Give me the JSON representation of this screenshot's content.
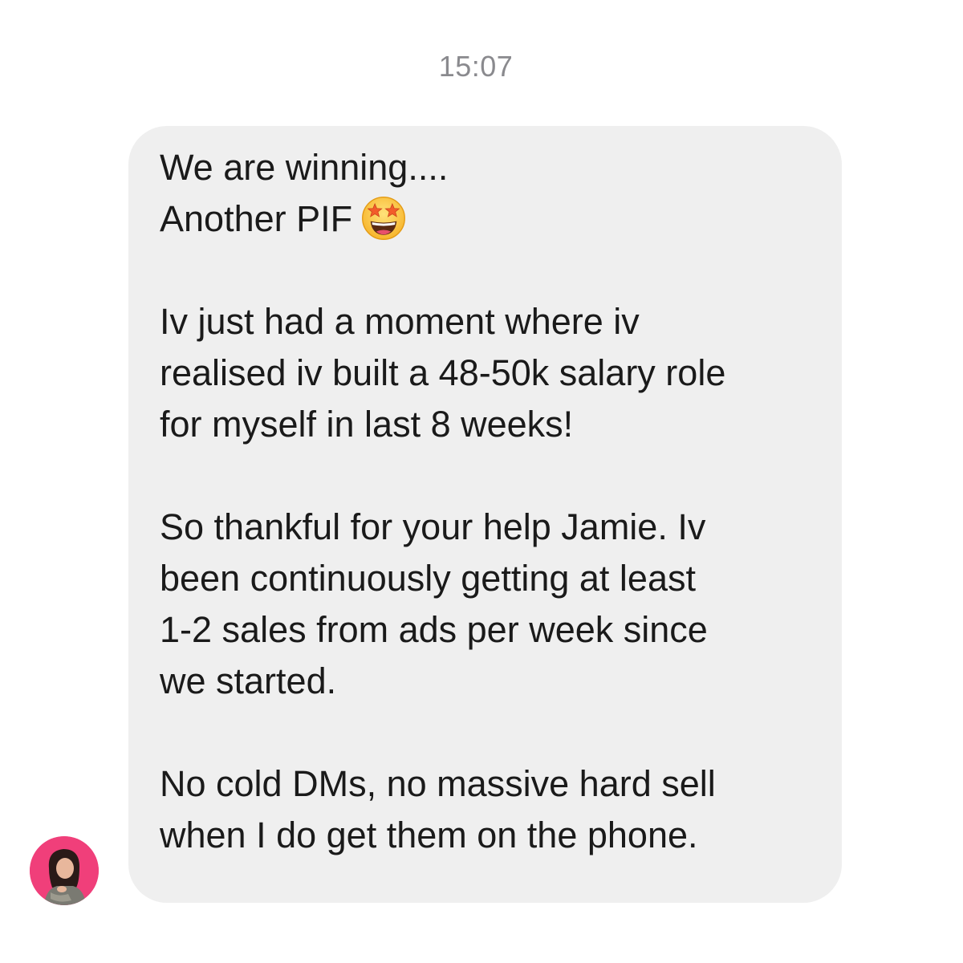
{
  "timestamp": "15:07",
  "message": {
    "paragraphs": [
      {
        "lines": [
          "We are winning....",
          "Another PIF"
        ],
        "emoji": "star-struck-emoji"
      },
      {
        "lines": [
          "Iv just had a moment where iv",
          "realised iv built a 48-50k salary role",
          "for myself in last 8 weeks!"
        ]
      },
      {
        "lines": [
          "So thankful for your help Jamie. Iv",
          "been continuously getting at least",
          "1-2 sales from ads per week since",
          "we started."
        ]
      },
      {
        "lines": [
          "No cold DMs, no massive hard sell",
          "when I do get them on the phone."
        ]
      }
    ]
  },
  "sender": {
    "avatar": "profile-photo-avatar",
    "avatar_color": "#f03f7a"
  },
  "colors": {
    "bubble": "#efefef",
    "text": "#1a1a1a",
    "timestamp": "#8a8a8e"
  }
}
